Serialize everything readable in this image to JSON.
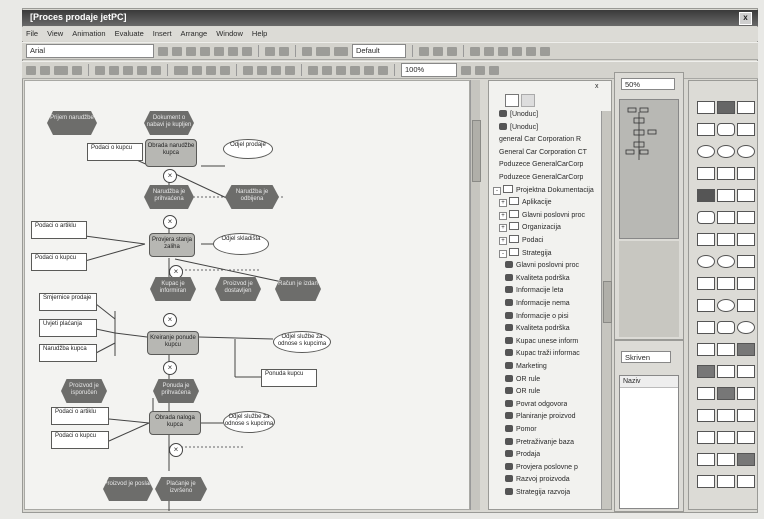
{
  "window": {
    "title": "[Proces prodaje jetPC]",
    "close_label": "x"
  },
  "menu": [
    "File",
    "View",
    "Animation",
    "Evaluate",
    "Insert",
    "Arrange",
    "Window",
    "Help"
  ],
  "toolbar": {
    "font_value": "Arial",
    "zoom_value": "Default",
    "nav_combo_value": "100%"
  },
  "diagram": {
    "events": [
      "Prijem narudžbe",
      "Dokument o nabavi je kupljen",
      "Narudžba je prihvaćena",
      "Narudžba je odbijena",
      "Kupac je informiran",
      "Proizvod je dostavljen",
      "Račun je izdan",
      "Proizvod je isporučen",
      "Ponuda je prihvaćena",
      "Proizvod je poslan",
      "Plaćanje je izvršeno"
    ],
    "functions": [
      "Obrada narudžbe kupca",
      "Provjera stanja zaliha",
      "Kreiranje ponude kupcu",
      "Obrada naloga kupca"
    ],
    "documents": [
      "Podaci o kupcu",
      "Podaci o artiklu",
      "Podaci o kupcu",
      "Smjernice prodaje",
      "Uvjeti plaćanja",
      "Narudžba kupca",
      "Podaci o artiklu",
      "Podaci o kupcu",
      "Ponuda kupcu"
    ],
    "orgs": [
      "Odjel prodaje",
      "Odjel skladišta",
      "Odjel službe za odnose s kupcima",
      "Odjel službe za odnose s kupcima"
    ],
    "connector_symbol": "×"
  },
  "explorer": {
    "items": [
      {
        "label": "[Unoduc]",
        "icon": "object-icon"
      },
      {
        "label": "[Unoduc]",
        "icon": "object-icon"
      },
      {
        "label": "general Car Corporation R",
        "icon": "none"
      },
      {
        "label": "General Car Corporation CT",
        "icon": "none"
      },
      {
        "label": "Poduzece GeneralCarCorp",
        "icon": "none"
      },
      {
        "label": "Poduzece GeneralCarCorp",
        "icon": "none"
      },
      {
        "label": "Projektna Dokumentacija",
        "icon": "folder-icon",
        "expander": "-"
      },
      {
        "label": "Aplikacije",
        "icon": "folder-icon",
        "expander": "+"
      },
      {
        "label": "Glavni poslovni proc",
        "icon": "folder-icon",
        "expander": "+"
      },
      {
        "label": "Organizacija",
        "icon": "folder-icon",
        "expander": "+"
      },
      {
        "label": "Podaci",
        "icon": "folder-icon",
        "expander": "+"
      },
      {
        "label": "Strategija",
        "icon": "folder-icon",
        "expander": "-"
      },
      {
        "label": "Glavni poslovni proc",
        "icon": "object-icon"
      },
      {
        "label": "Kvaliteta podrška",
        "icon": "object-icon"
      },
      {
        "label": "Informacije leta",
        "icon": "object-icon"
      },
      {
        "label": "Informacije nema",
        "icon": "object-icon"
      },
      {
        "label": "Informacije o pisi",
        "icon": "object-icon"
      },
      {
        "label": "Kvaliteta podrška",
        "icon": "object-icon"
      },
      {
        "label": "Kupac unese inform",
        "icon": "object-icon"
      },
      {
        "label": "Kupac traži informac",
        "icon": "object-icon"
      },
      {
        "label": "Marketing",
        "icon": "object-icon"
      },
      {
        "label": "OR rule",
        "icon": "object-icon"
      },
      {
        "label": "OR rule",
        "icon": "object-icon"
      },
      {
        "label": "Povrat odgovora",
        "icon": "object-icon"
      },
      {
        "label": "Planiranje proizvod",
        "icon": "object-icon"
      },
      {
        "label": "Pomor",
        "icon": "object-icon"
      },
      {
        "label": "Pretraživanje baza",
        "icon": "object-icon"
      },
      {
        "label": "Prodaja",
        "icon": "object-icon"
      },
      {
        "label": "Provjera poslovne p",
        "icon": "object-icon"
      },
      {
        "label": "Razvoj proizvoda",
        "icon": "object-icon"
      },
      {
        "label": "Strategija razvoja",
        "icon": "object-icon"
      }
    ]
  },
  "navigator": {
    "combo_value": "50%",
    "close_label": "x"
  },
  "properties": {
    "dropdown_label": "Skriven",
    "list_header": "Naziv"
  }
}
